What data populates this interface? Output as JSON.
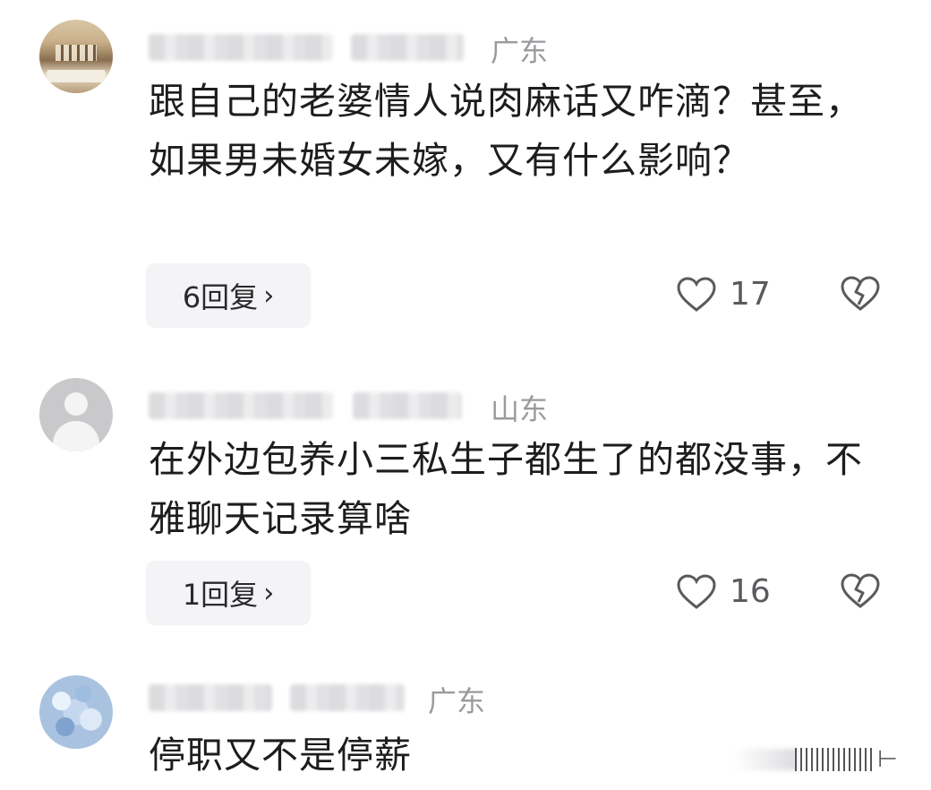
{
  "comments": [
    {
      "region": "广东",
      "text": "跟自己的老婆情人说肉麻话又咋滴？甚至，如果男未婚女未嫁，又有什么影响？",
      "replies_label": "6回复",
      "likes": "17"
    },
    {
      "region": "山东",
      "text": "在外边包养小三私生子都生了的都没事，不雅聊天记录算啥",
      "replies_label": "1回复",
      "likes": "16"
    },
    {
      "region": "广东",
      "text": "停职又不是停薪"
    }
  ],
  "icons": {
    "like": "heart-outline-icon",
    "dislike": "broken-heart-icon",
    "reply_chevron": "chevron-right-icon"
  },
  "colors": {
    "region": "#9b9b9f",
    "text": "#1d1d1f",
    "reply_bg": "#f4f4f6"
  }
}
